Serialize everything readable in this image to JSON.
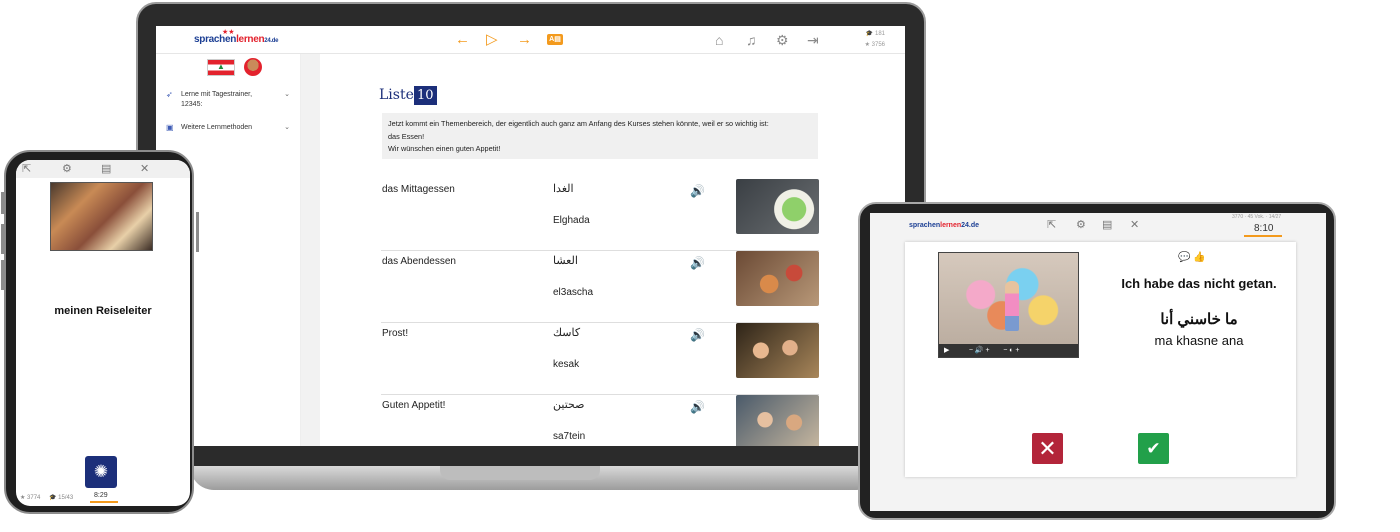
{
  "laptop": {
    "logo": {
      "part1": "sprachen",
      "part2": "lernen",
      "part3": "24.de"
    },
    "stats": {
      "stars": "181",
      "points": "3756"
    },
    "sidebar": {
      "items": [
        {
          "label": "Lerne mit Tagestrainer, 12345:"
        },
        {
          "label": "Weitere Lernmethoden"
        }
      ]
    },
    "list": {
      "title": "Liste",
      "number": "10",
      "intro_lines": [
        "Jetzt kommt ein Themenbereich, der eigentlich auch ganz am Anfang des Kurses stehen könnte, weil er so wichtig ist:",
        "das Essen!",
        "Wir wünschen einen guten Appetit!"
      ],
      "rows": [
        {
          "german": "das Mittagessen",
          "arabic": "الغدا",
          "translit": "Elghada"
        },
        {
          "german": "das Abendessen",
          "arabic": "العشا",
          "translit": "el3ascha"
        },
        {
          "german": "Prost!",
          "arabic": "كاسك",
          "translit": "kesak"
        },
        {
          "german": "Guten Appetit!",
          "arabic": "صحتين",
          "translit": "sa7tein"
        }
      ]
    }
  },
  "phone": {
    "word": "meinen Reiseleiter",
    "stats_left": "3774",
    "stats_right": "15/43",
    "time": "8:29"
  },
  "tablet": {
    "logo": {
      "part1": "sprachen",
      "part2": "lernen",
      "part3": "24.de"
    },
    "stats": "3770 · 45 Vok. · 14/27",
    "time": "8:10",
    "german": "Ich habe das nicht getan.",
    "arabic": "ما خاسني أنا",
    "translit": "ma khasne ana"
  },
  "colors": {
    "brand_blue": "#1c2f7a",
    "accent_orange": "#f39a1d",
    "wrong_red": "#b3253a",
    "right_green": "#22a04a"
  },
  "icons": [
    "arrow-left-icon",
    "play-icon",
    "arrow-right-icon",
    "card-icon",
    "home-icon",
    "music-icon",
    "gear-icon",
    "logout-icon",
    "speaker-icon",
    "bulb-icon",
    "close-icon",
    "check-icon"
  ]
}
